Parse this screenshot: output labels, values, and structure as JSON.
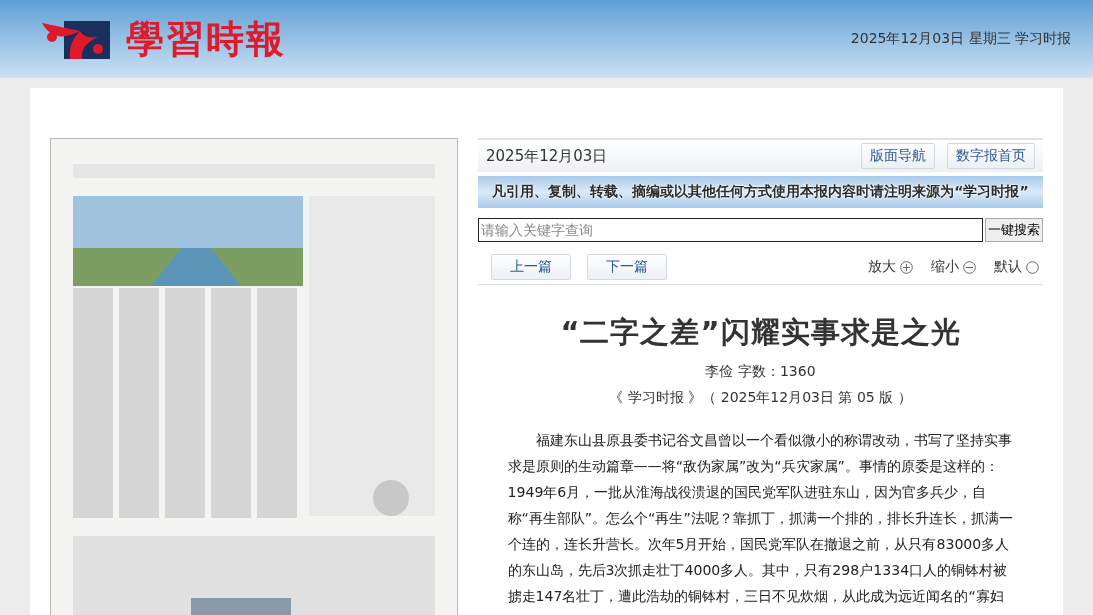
{
  "header": {
    "logo_text": "學習時報",
    "date_line": "2025年12月03日 星期三 学习时报"
  },
  "toolbar": {
    "date": "2025年12月03日",
    "buttons": [
      "版面导航",
      "数字报首页"
    ]
  },
  "notice_banner": "凡引用、复制、转载、摘编或以其他任何方式使用本报内容时请注明来源为“学习时报”",
  "search": {
    "placeholder": "请输入关键字查询",
    "button": "一键搜索"
  },
  "article_nav": {
    "buttons": [
      "上一篇",
      "下一篇"
    ],
    "zoom_controls": [
      {
        "label": "放大",
        "kind": "plus"
      },
      {
        "label": "缩小",
        "kind": "minus"
      },
      {
        "label": "默认",
        "kind": "reset"
      }
    ]
  },
  "article": {
    "title": "“二字之差”闪耀实事求是之光",
    "byline": "李俭 字数：1360",
    "source": "《 学习时报 》（ 2025年12月03日 第 05 版 ）",
    "paragraphs": [
      "福建东山县原县委书记谷文昌曾以一个看似微小的称谓改动，书写了坚持实事求是原则的生动篇章——将“敌伪家属”改为“兵灾家属”。事情的原委是这样的：1949年6月，一批从淮海战役溃退的国民党军队进驻东山，因为官多兵少，自称“再生部队”。怎么个“再生”法呢？靠抓丁，抓满一个排的，排长升连长，抓满一个连的，连长升营长。次年5月开始，国民党军队在撤退之前，从只有83000多人的东山岛，先后3次抓走壮丁4000多人。其中，只有298户1334口人的铜钵村被掳走147名壮丁，遭此浩劫的铜钵村，三日不见炊烟，从此成为远近闻名的“寡妇"
    ]
  }
}
